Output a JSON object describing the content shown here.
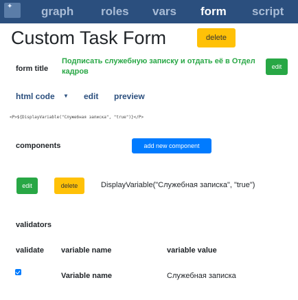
{
  "nav": {
    "tabs": [
      {
        "label": "graph"
      },
      {
        "label": "roles"
      },
      {
        "label": "vars"
      },
      {
        "label": "form"
      },
      {
        "label": "script"
      }
    ],
    "active": "form"
  },
  "page": {
    "title": "Custom Task Form",
    "delete_label": "delete"
  },
  "form_title": {
    "label": "form title",
    "value": "Подписать служебную записку и отдать её в Отдел кадров",
    "edit_label": "edit"
  },
  "subtabs": {
    "html_code": "html code",
    "edit": "edit",
    "preview": "preview"
  },
  "html_code": "<P>${DisplayVariable(\"Служебная записка\", \"true\")}</P>",
  "components": {
    "label": "components",
    "add_label": "add new component",
    "items": [
      {
        "edit_label": "edit",
        "delete_label": "delete",
        "text": "DisplayVariable(\"Служебная записка\", \"true\")"
      }
    ]
  },
  "validators": {
    "label": "validators",
    "columns": [
      "validate",
      "variable name",
      "variable value"
    ],
    "rows": [
      {
        "validate": true,
        "name": "Variable name",
        "value": "Служебная записка"
      }
    ]
  },
  "colors": {
    "nav_bg": "#2b4f7e",
    "success": "#28a745",
    "warning": "#ffc107",
    "primary": "#007bff"
  },
  "icons": {
    "nav_logo": "sparkle-icon",
    "subtab_dropdown": "caret-down-icon",
    "validate_checkbox": "check-icon"
  }
}
